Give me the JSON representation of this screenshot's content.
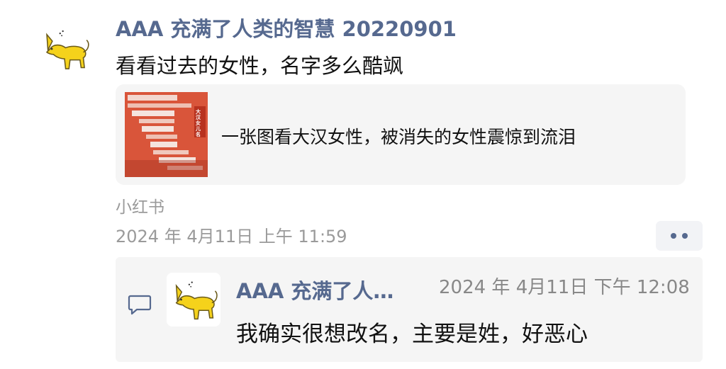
{
  "post": {
    "author": "AAA 充满了人类的智慧 20220901",
    "text": "看看过去的女性，名字多么酷飒",
    "avatar_icon": "yellow-cat-icon",
    "link": {
      "title": "一张图看大汉女性，被消失的女性震惊到流泪",
      "thumbnail_icon": "infographic-thumbnail",
      "thumbnail_text": "大汉女儿名录"
    },
    "source": "小红书",
    "timestamp": "2024 年 4月11日 上午 11:59"
  },
  "comment": {
    "author": "AAA 充满了人…",
    "time": "2024 年 4月11日 下午 12:08",
    "text": "我确实很想改名，主要是姓，好恶心",
    "avatar_icon": "yellow-cat-icon",
    "icon": "comment-icon"
  },
  "colors": {
    "name": "#56698f",
    "card": "#f5f5f5",
    "thumbnail": "#d9553a"
  }
}
